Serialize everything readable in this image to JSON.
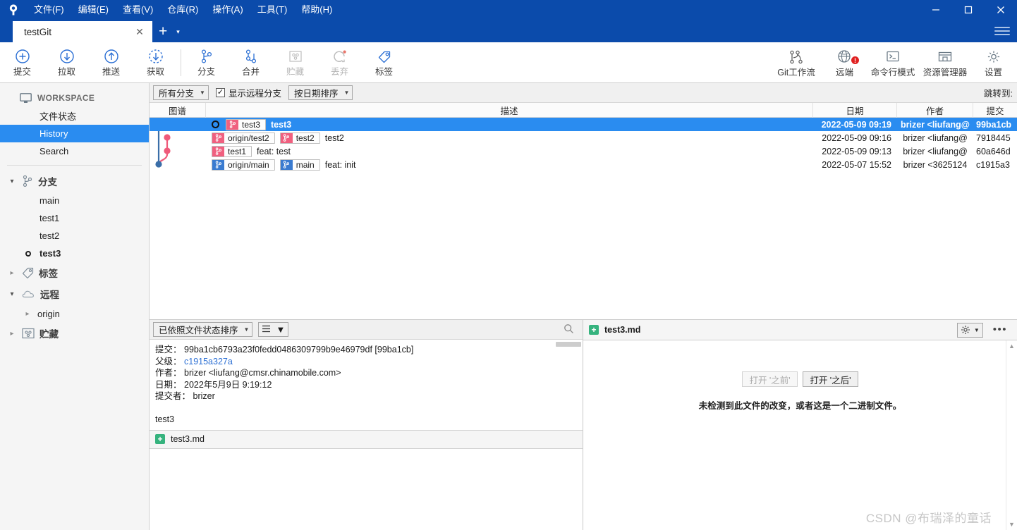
{
  "window": {
    "menus": [
      {
        "label": "文件(F)",
        "mnemonic": "F"
      },
      {
        "label": "编辑(E)",
        "mnemonic": "E"
      },
      {
        "label": "查看(V)",
        "mnemonic": "V"
      },
      {
        "label": "仓库(R)",
        "mnemonic": "R"
      },
      {
        "label": "操作(A)",
        "mnemonic": "A"
      },
      {
        "label": "工具(T)",
        "mnemonic": "T"
      },
      {
        "label": "帮助(H)",
        "mnemonic": "H"
      }
    ],
    "controls": {
      "minimize": "—",
      "maximize": "□",
      "close": "✕"
    }
  },
  "tabs": {
    "items": [
      {
        "label": "testGit",
        "close": "✕",
        "active": true
      }
    ],
    "add_label": "+",
    "caret": "▾"
  },
  "toolbar": {
    "left": [
      {
        "label": "提交",
        "icon": "commit-plus-icon",
        "disabled": false
      },
      {
        "label": "拉取",
        "icon": "pull-down-arrow-icon",
        "disabled": false
      },
      {
        "label": "推送",
        "icon": "push-up-arrow-icon",
        "disabled": false
      },
      {
        "label": "获取",
        "icon": "fetch-dashed-arrow-icon",
        "disabled": false
      },
      {
        "label": "分支",
        "icon": "branch-icon",
        "disabled": false
      },
      {
        "label": "合并",
        "icon": "merge-icon",
        "disabled": false
      },
      {
        "label": "贮藏",
        "icon": "stash-icon",
        "disabled": true
      },
      {
        "label": "丢弃",
        "icon": "discard-refresh-icon",
        "disabled": true
      },
      {
        "label": "标签",
        "icon": "tag-icon",
        "disabled": false
      }
    ],
    "right": [
      {
        "label": "Git工作流",
        "icon": "git-flow-icon",
        "badge": ""
      },
      {
        "label": "远端",
        "icon": "remote-globe-icon",
        "badge": "!"
      },
      {
        "label": "命令行模式",
        "icon": "terminal-icon",
        "badge": ""
      },
      {
        "label": "资源管理器",
        "icon": "explorer-folder-icon",
        "badge": ""
      },
      {
        "label": "设置",
        "icon": "gear-icon",
        "badge": ""
      }
    ]
  },
  "sidebar": {
    "workspace_label": "WORKSPACE",
    "workspace_items": [
      {
        "label": "文件状态",
        "selected": false
      },
      {
        "label": "History",
        "selected": true
      },
      {
        "label": "Search",
        "selected": false
      }
    ],
    "branches": {
      "label": "分支",
      "expanded": true,
      "items": [
        {
          "label": "main",
          "current": false
        },
        {
          "label": "test1",
          "current": false
        },
        {
          "label": "test2",
          "current": false
        },
        {
          "label": "test3",
          "current": true
        }
      ]
    },
    "tags": {
      "label": "标签",
      "expanded": false
    },
    "remotes": {
      "label": "远程",
      "expanded": true,
      "items": [
        {
          "label": "origin"
        }
      ]
    },
    "stashes": {
      "label": "贮藏",
      "expanded": false
    }
  },
  "history": {
    "filters": {
      "branch_filter": "所有分支",
      "show_remote_label": "显示远程分支",
      "show_remote_checked": true,
      "sort": "按日期排序",
      "jump_to_label": "跳转到:"
    },
    "columns": [
      {
        "key": "graph",
        "label": "图谱"
      },
      {
        "key": "desc",
        "label": "描述"
      },
      {
        "key": "date",
        "label": "日期"
      },
      {
        "key": "author",
        "label": "作者"
      },
      {
        "key": "commit",
        "label": "提交"
      }
    ],
    "rows": [
      {
        "selected": true,
        "refs": [
          {
            "name": "test3",
            "color": "pink",
            "kind": "local"
          }
        ],
        "message": "test3",
        "date": "2022-05-09 09:19",
        "author": "brizer <liufang@",
        "commit": "99ba1cb"
      },
      {
        "selected": false,
        "refs": [
          {
            "name": "origin/test2",
            "color": "pink",
            "kind": "remote"
          },
          {
            "name": "test2",
            "color": "pink",
            "kind": "local"
          }
        ],
        "message": "test2",
        "date": "2022-05-09 09:16",
        "author": "brizer <liufang@",
        "commit": "7918445"
      },
      {
        "selected": false,
        "refs": [
          {
            "name": "test1",
            "color": "pink",
            "kind": "local"
          }
        ],
        "message": "feat: test",
        "date": "2022-05-09 09:13",
        "author": "brizer <liufang@",
        "commit": "60a646d"
      },
      {
        "selected": false,
        "refs": [
          {
            "name": "origin/main",
            "color": "blue",
            "kind": "remote"
          },
          {
            "name": "main",
            "color": "blue",
            "kind": "local"
          }
        ],
        "message": "feat: init",
        "date": "2022-05-07 15:52",
        "author": "brizer <3625124",
        "commit": "c1915a3"
      }
    ]
  },
  "detail_panel": {
    "sort_select": "已依照文件状态排序",
    "view_select_icon": "list-view-icon",
    "search_icon": "search-icon",
    "fields": [
      {
        "key": "提交：",
        "value": "99ba1cb6793a23f0fedd0486309799b9e46979df [99ba1cb]",
        "link": false
      },
      {
        "key": "父级：",
        "value": "c1915a327a",
        "link": true
      },
      {
        "key": "作者：",
        "value": "brizer <liufang@cmsr.chinamobile.com>",
        "link": false
      },
      {
        "key": "日期：",
        "value": "2022年5月9日 9:19:12",
        "link": false
      },
      {
        "key": "提交者：",
        "value": "brizer",
        "link": false
      }
    ],
    "body_message": "test3",
    "file_list": [
      {
        "name": "test3.md",
        "status": "added",
        "status_icon": "plus-icon"
      }
    ]
  },
  "diff_panel": {
    "file_name": "test3.md",
    "file_status_icon": "plus-icon",
    "gear_icon": "gear-icon",
    "caret_icon": "chevron-down-icon",
    "more_icon": "more-dots-icon",
    "open_before_label": "打开 '之前'",
    "open_before_disabled": true,
    "open_after_label": "打开 '之后'",
    "open_after_disabled": false,
    "no_change_note": "未检测到此文件的改变，或者这是一个二进制文件。",
    "scroll_up_icon": "chevron-up-icon",
    "scroll_down_icon": "chevron-down-icon"
  },
  "watermark": "CSDN @布瑞泽的童话",
  "colors": {
    "titlebar": "#0b4bab",
    "selection": "#2a8cf0",
    "pink_ref": "#f0607f",
    "blue_ref": "#3a7bd0",
    "added_green": "#36b37e",
    "badge_red": "#e02020"
  }
}
